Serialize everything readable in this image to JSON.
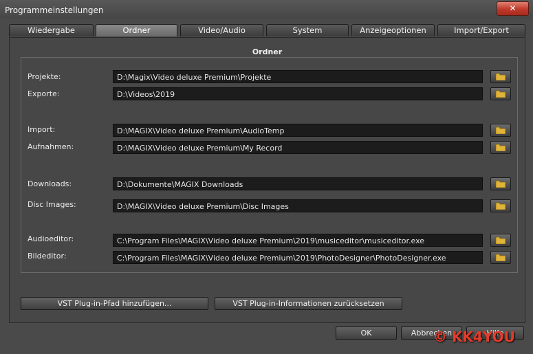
{
  "window": {
    "title": "Programmeinstellungen",
    "close_glyph": "✕"
  },
  "tabs": [
    {
      "label": "Wiedergabe"
    },
    {
      "label": "Ordner"
    },
    {
      "label": "Video/Audio"
    },
    {
      "label": "System"
    },
    {
      "label": "Anzeigeoptionen"
    },
    {
      "label": "Import/Export"
    }
  ],
  "active_tab": "Ordner",
  "group_title": "Ordner",
  "folders": [
    {
      "label": "Projekte:",
      "path": "D:\\Magix\\Video deluxe Premium\\Projekte"
    },
    {
      "label": "Exporte:",
      "path": "D:\\Videos\\2019"
    },
    {
      "label": "Import:",
      "path": "D:\\MAGIX\\Video deluxe Premium\\AudioTemp"
    },
    {
      "label": "Aufnahmen:",
      "path": "D:\\MAGIX\\Video deluxe Premium\\My Record"
    },
    {
      "label": "Downloads:",
      "path": "D:\\Dokumente\\MAGIX Downloads"
    },
    {
      "label": "Disc Images:",
      "path": "D:\\MAGIX\\Video deluxe Premium\\Disc Images"
    },
    {
      "label": "Audioeditor:",
      "path": "C:\\Program Files\\MAGIX\\Video deluxe Premium\\2019\\musiceditor\\musiceditor.exe"
    },
    {
      "label": "Bildeditor:",
      "path": "C:\\Program Files\\MAGIX\\Video deluxe Premium\\2019\\PhotoDesigner\\PhotoDesigner.exe"
    }
  ],
  "vst": {
    "add_path": "VST Plug-in-Pfad hinzufügen...",
    "reset_info": "VST Plug-in-Informationen zurücksetzen"
  },
  "footer": {
    "ok": "OK",
    "cancel": "Abbrechen",
    "help": "Hilfe"
  },
  "watermark": "© KK4YOU",
  "colors": {
    "background": "#4a4a4a",
    "field": "#1c1c1c",
    "folder_icon": "#e0b43a",
    "close": "#c0392b",
    "watermark": "#e53b2a"
  }
}
